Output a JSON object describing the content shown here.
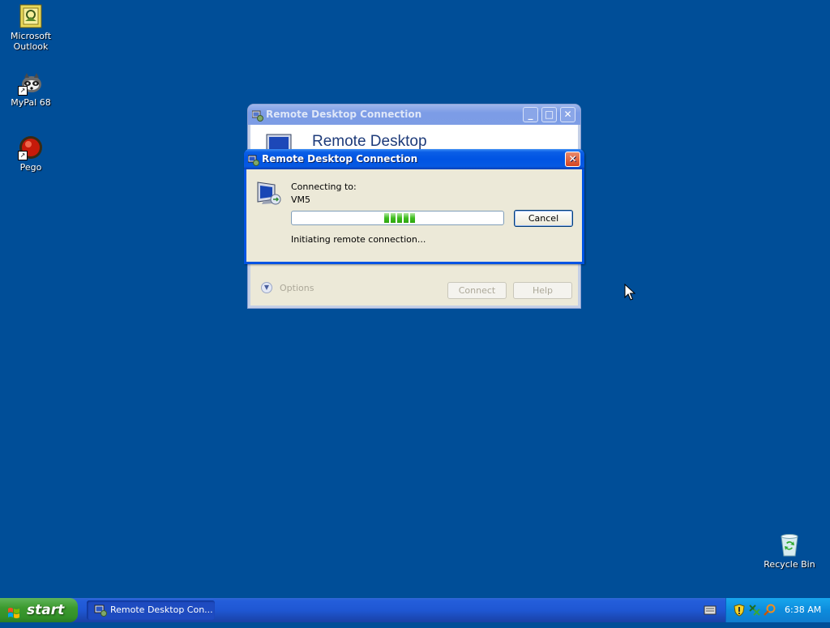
{
  "desktop": {
    "icons": [
      {
        "label_line1": "Microsoft",
        "label_line2": "Outlook",
        "icon": "outlook-icon"
      },
      {
        "label": "MyPal 68",
        "icon": "mypal-icon"
      },
      {
        "label": "Pego",
        "icon": "pego-icon"
      },
      {
        "label": "Recycle Bin",
        "icon": "recycle-bin-icon"
      }
    ]
  },
  "back_window": {
    "title": "Remote Desktop Connection",
    "banner_text": "Remote Desktop",
    "options_label": "Options",
    "connect_label": "Connect",
    "help_label": "Help"
  },
  "dialog": {
    "title": "Remote Desktop Connection",
    "connecting_label": "Connecting to:",
    "host": "VM5",
    "cancel_label": "Cancel",
    "status": "Initiating remote connection..."
  },
  "taskbar": {
    "start_label": "start",
    "task_label": "Remote Desktop Con...",
    "clock": "6:38 AM"
  },
  "colors": {
    "desktop_bg": "#004e98",
    "title_active": "#0054e3",
    "start_green": "#3c9a2e",
    "tray_blue": "#0d8cdc"
  }
}
